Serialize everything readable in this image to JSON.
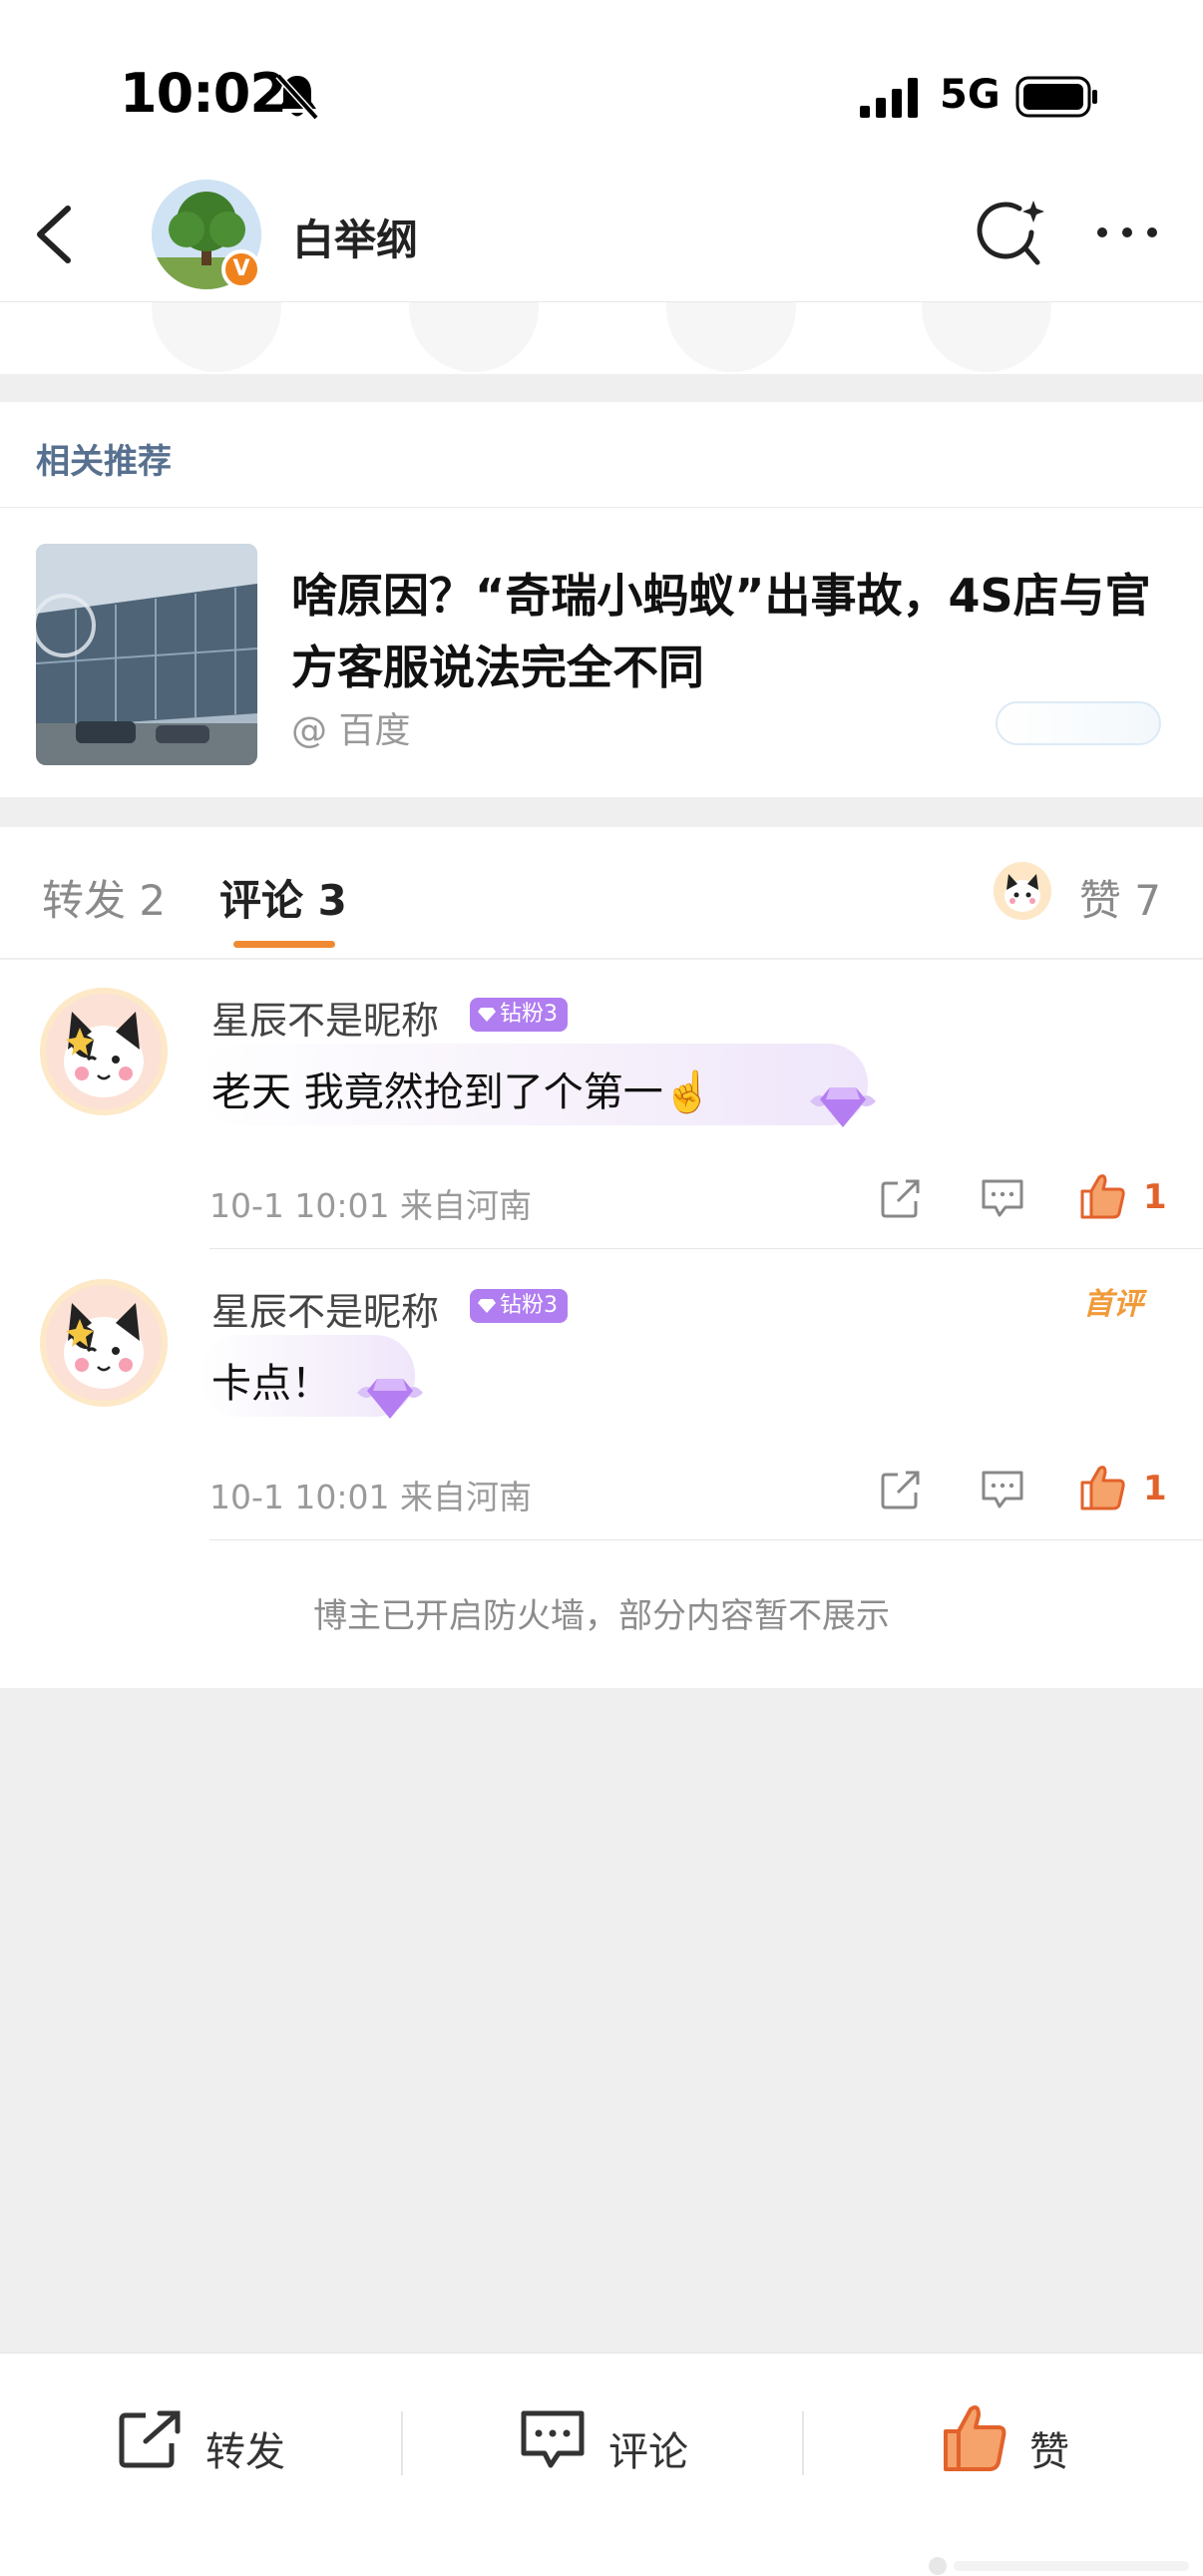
{
  "status_bar": {
    "time": "10:02",
    "network": "5G",
    "icons": [
      "bell-off-icon",
      "signal-icon",
      "battery-icon"
    ]
  },
  "header": {
    "username": "白举纲",
    "verified_badge": "V",
    "icons": [
      "back-icon",
      "ai-search-icon",
      "more-icon"
    ]
  },
  "related": {
    "section_title": "相关推荐",
    "news_title": "啥原因？“奇瑞小蚂蚁”出事故，4S店与官方客服说法完全不同",
    "news_source": "@ 百度"
  },
  "tabs": {
    "repost": "转发 2",
    "comment": "评论 3",
    "like": "赞 7",
    "active": "comment"
  },
  "comments": [
    {
      "name": "星辰不是昵称",
      "badge": "钻粉3",
      "text": "老天 我竟然抢到了个第一☝️",
      "meta": "10-1 10:01 来自河南",
      "likes": "1"
    },
    {
      "name": "星辰不是昵称",
      "badge": "钻粉3",
      "text": "卡点！",
      "meta": "10-1 10:01 来自河南",
      "likes": "1",
      "tag": "首评"
    }
  ],
  "firewall_notice": "博主已开启防火墙，部分内容暂不展示",
  "bottom_bar": {
    "repost": "转发",
    "comment": "评论",
    "like": "赞"
  },
  "colors": {
    "accent": "#f08a32",
    "like": "#e2622b",
    "badge": "#b07ef0",
    "link": "#57708f"
  }
}
